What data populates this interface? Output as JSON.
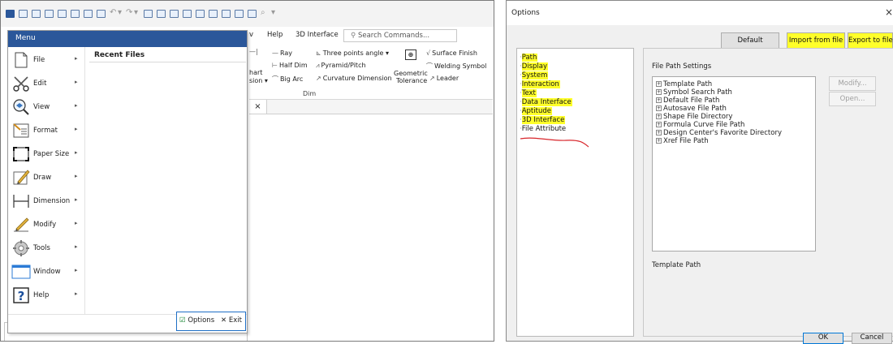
{
  "app": {
    "ribbon_tabs": [
      "v",
      "Help",
      "3D Interface"
    ],
    "search_placeholder": "Search Commands...",
    "ribbon": {
      "ray": "Ray",
      "three_points_angle": "Three points angle",
      "surface_finish": "Surface Finish",
      "half_dim": "Half Dim",
      "pyramid_pitch": "Pyramid/Pitch",
      "welding_symbol": "Welding Symbol",
      "chart_partial": "hart",
      "dimension_partial": "sion",
      "big_arc": "Big Arc",
      "curvature_dimension": "Curvature Dimension",
      "geometric_tolerance_1": "Geometric",
      "geometric_tolerance_2": "Tolerance",
      "leader": "Leader",
      "group_dim": "Dim"
    },
    "doc_tab_close": "×"
  },
  "menu": {
    "title": "Menu",
    "items": [
      {
        "label": "File",
        "icon": "file-icon"
      },
      {
        "label": "Edit",
        "icon": "scissors-icon"
      },
      {
        "label": "View",
        "icon": "view-icon"
      },
      {
        "label": "Format",
        "icon": "format-icon"
      },
      {
        "label": "Paper Size",
        "icon": "paper-size-icon"
      },
      {
        "label": "Draw",
        "icon": "draw-icon"
      },
      {
        "label": "Dimension",
        "icon": "dimension-icon"
      },
      {
        "label": "Modify",
        "icon": "modify-icon"
      },
      {
        "label": "Tools",
        "icon": "tools-icon"
      },
      {
        "label": "Window",
        "icon": "window-icon"
      },
      {
        "label": "Help",
        "icon": "help-icon"
      }
    ],
    "recent_files_title": "Recent Files",
    "options_label": "Options",
    "exit_label": "Exit"
  },
  "dialog": {
    "title": "Options",
    "close": "×",
    "default_btn": "Default",
    "import_btn": "Import from file",
    "export_btn": "Export to file",
    "tree": [
      "Path",
      "Display",
      "System",
      "Interaction",
      "Text",
      "Data Interface",
      "Aptitude",
      "3D Interface",
      "File Attribute"
    ],
    "file_path_settings_label": "File Path Settings",
    "file_paths": [
      "Template Path",
      "Symbol Search Path",
      "Default File Path",
      "Autosave File Path",
      "Shape File Directory",
      "Formula Curve File Path",
      "Design Center's Favorite Directory",
      "Xref File Path"
    ],
    "modify_btn": "Modify...",
    "open_btn": "Open...",
    "selected_path_label": "Template Path",
    "ok_btn": "OK",
    "cancel_btn": "Cancel",
    "highlight_color": "#ffff2a"
  }
}
